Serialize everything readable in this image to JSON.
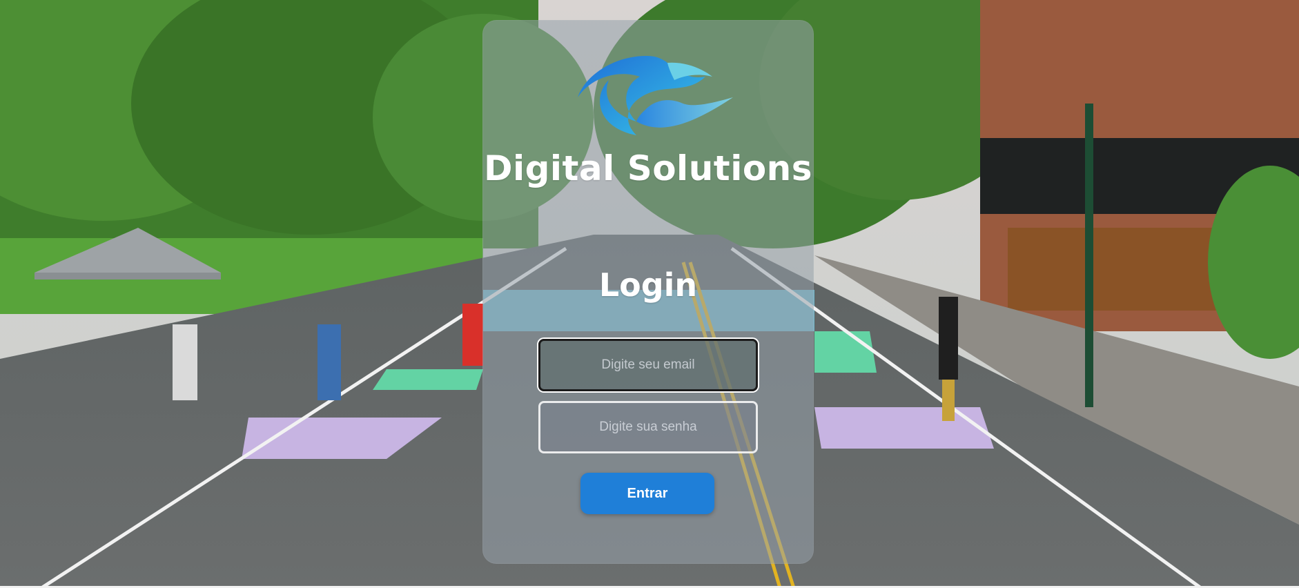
{
  "brand": {
    "name": "Digital Solutions",
    "logo_icon": "wave-swirl-logo-icon",
    "logo_colors": [
      "#1f6fd6",
      "#38c6e8",
      "#7fd1e0"
    ]
  },
  "login": {
    "title": "Login",
    "email_placeholder": "Digite seu email",
    "email_value": "",
    "password_placeholder": "Digite sua senha",
    "password_value": "",
    "submit_label": "Entrar"
  },
  "colors": {
    "button": "#1f7fd8",
    "card_overlay": "rgba(150,160,170,0.55)"
  }
}
